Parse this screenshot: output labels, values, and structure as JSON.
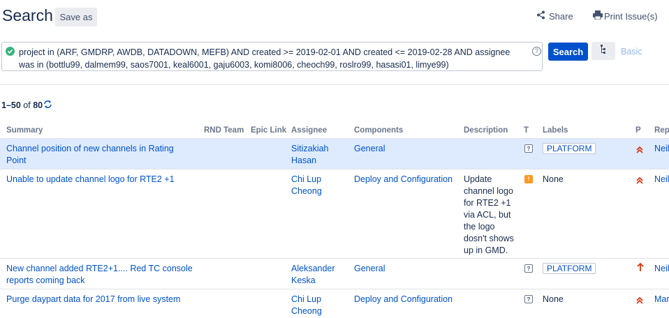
{
  "header": {
    "title": "Search",
    "save_as": "Save as",
    "share": "Share",
    "print": "Print Issue(s)"
  },
  "query": {
    "line1": "project in (ARF, GMDRP, AWDB, DATADOWN, MEFB) AND created >= 2019-02-01 AND created <= 2019-02-28 AND assignee",
    "line2": "was in (bottlu99, dalmem99, saos7001, keal6001, gaju6003, komi8006, cheoch99, roslro99, hasasi01, limye99)",
    "help": "?",
    "search_button": "Search",
    "basic_link": "Basic"
  },
  "results": {
    "range": "1–50",
    "of": "of",
    "total": "80"
  },
  "table": {
    "headers": [
      "Summary",
      "RND Team",
      "Epic Link",
      "Assignee",
      "Components",
      "Description",
      "T",
      "Labels",
      "P",
      "Rep"
    ],
    "rows": [
      {
        "summary": "Channel position of new channels in Rating Point",
        "assignee": "Sitizakiah Hasan",
        "component": "General",
        "description": "",
        "type": "?",
        "label": "PLATFORM",
        "priority": "highest",
        "reporter": "Neil"
      },
      {
        "summary": "Unable to update channel logo for RTE2 +1",
        "assignee": "Chi Lup Cheong",
        "component": "Deploy and Configuration",
        "description": "Update channel logo for RTE2 +1 via ACL, but the logo dosn't shows up in GMD.",
        "type": "!",
        "label": "None",
        "priority": "highest",
        "reporter": "Neil"
      },
      {
        "summary": "New channel added RTE2+1.... Red TC console reports coming back",
        "assignee": "Aleksander Keska",
        "component": "General",
        "description": "",
        "type": "?",
        "label": "PLATFORM",
        "priority": "high",
        "reporter": "Neil"
      },
      {
        "summary": "Purge daypart data for 2017 from live system",
        "assignee": "Chi Lup Cheong",
        "component": "Deploy and Configuration",
        "description": "",
        "type": "?",
        "label": "None",
        "priority": "highest",
        "reporter": "Mar"
      }
    ]
  },
  "icons": {
    "check": "check-circle-icon",
    "share": "share-icon",
    "print": "printer-icon",
    "refresh": "refresh-icon",
    "tree": "tree-icon"
  },
  "colors": {
    "primary": "#0052cc",
    "selected_row": "#deebff",
    "success": "#36b37e",
    "priority": "#de350b",
    "bug": "#ff991f"
  }
}
